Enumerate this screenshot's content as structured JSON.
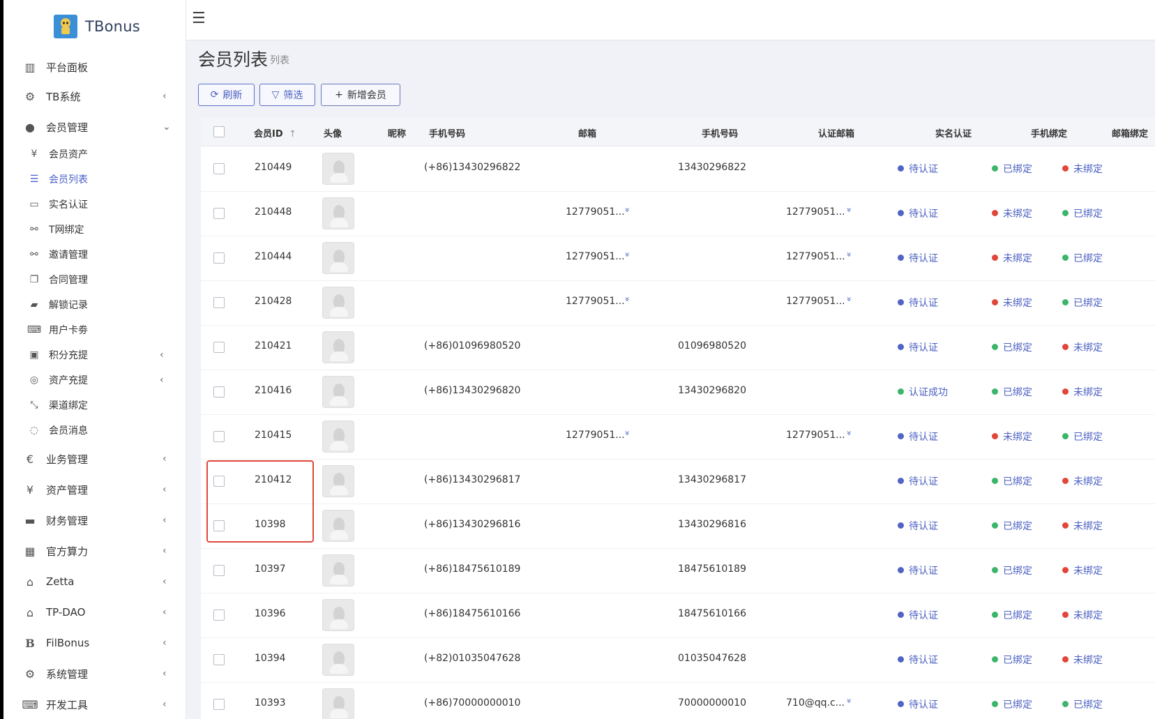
{
  "brand": {
    "name": "TBonus"
  },
  "sidebar": {
    "items": [
      {
        "label": "平台面板",
        "icon": "bar-chart-icon",
        "chev": ""
      },
      {
        "label": "TB系统",
        "icon": "cog-icon",
        "chev": "‹"
      },
      {
        "label": "会员管理",
        "icon": "user-icon",
        "chev": "⌄"
      },
      {
        "label": "会员资产",
        "icon": "yen-icon",
        "chev": ""
      },
      {
        "label": "会员列表",
        "icon": "list-icon",
        "chev": ""
      },
      {
        "label": "实名认证",
        "icon": "id-card-icon",
        "chev": ""
      },
      {
        "label": "T网绑定",
        "icon": "link-icon",
        "chev": ""
      },
      {
        "label": "邀请管理",
        "icon": "link-icon",
        "chev": ""
      },
      {
        "label": "合同管理",
        "icon": "file-copy-icon",
        "chev": ""
      },
      {
        "label": "解锁记录",
        "icon": "book-icon",
        "chev": ""
      },
      {
        "label": "用户卡劵",
        "icon": "keyboard-icon",
        "chev": ""
      },
      {
        "label": "积分充提",
        "icon": "database-icon",
        "chev": "‹"
      },
      {
        "label": "资产充提",
        "icon": "target-icon",
        "chev": "‹"
      },
      {
        "label": "渠道绑定",
        "icon": "compress-icon",
        "chev": ""
      },
      {
        "label": "会员消息",
        "icon": "comment-icon",
        "chev": ""
      },
      {
        "label": "业务管理",
        "icon": "euro-icon",
        "chev": "‹"
      },
      {
        "label": "资产管理",
        "icon": "yen-icon",
        "chev": "‹"
      },
      {
        "label": "财务管理",
        "icon": "discover-card-icon",
        "chev": "‹"
      },
      {
        "label": "官方算力",
        "icon": "calculator-icon",
        "chev": "‹"
      },
      {
        "label": "Zetta",
        "icon": "bank-icon",
        "chev": "‹"
      },
      {
        "label": "TP-DAO",
        "icon": "bank-icon",
        "chev": "‹"
      },
      {
        "label": "FilBonus",
        "icon": "bold-b-icon",
        "chev": "‹"
      },
      {
        "label": "系统管理",
        "icon": "gear-icon",
        "chev": "‹"
      },
      {
        "label": "开发工具",
        "icon": "keyboard-icon",
        "chev": "‹"
      }
    ]
  },
  "page": {
    "title": "会员列表",
    "subtitle": "列表"
  },
  "toolbar": {
    "refresh": "刷新",
    "filter": "筛选",
    "add": "新增会员"
  },
  "table": {
    "headers": [
      "会员ID",
      "头像",
      "昵称",
      "手机号码",
      "邮箱",
      "手机号码",
      "认证邮箱",
      "实名认证",
      "手机绑定",
      "邮箱绑定"
    ],
    "sort_icon": "↑",
    "rows": [
      {
        "id": "210449",
        "phone_full": "(+86)13430296822",
        "email": "",
        "phone": "13430296822",
        "auth_email": "",
        "realname": "待认证",
        "phone_bind": "已绑定",
        "email_bind": "未绑定"
      },
      {
        "id": "210448",
        "phone_full": "",
        "email": "12779051...",
        "phone": "",
        "auth_email": "12779051...",
        "realname": "待认证",
        "phone_bind": "未绑定",
        "email_bind": "已绑定"
      },
      {
        "id": "210444",
        "phone_full": "",
        "email": "12779051...",
        "phone": "",
        "auth_email": "12779051...",
        "realname": "待认证",
        "phone_bind": "未绑定",
        "email_bind": "已绑定"
      },
      {
        "id": "210428",
        "phone_full": "",
        "email": "12779051...",
        "phone": "",
        "auth_email": "12779051...",
        "realname": "待认证",
        "phone_bind": "未绑定",
        "email_bind": "已绑定"
      },
      {
        "id": "210421",
        "phone_full": "(+86)01096980520",
        "email": "",
        "phone": "01096980520",
        "auth_email": "",
        "realname": "待认证",
        "phone_bind": "已绑定",
        "email_bind": "未绑定"
      },
      {
        "id": "210416",
        "phone_full": "(+86)13430296820",
        "email": "",
        "phone": "13430296820",
        "auth_email": "",
        "realname": "认证成功",
        "phone_bind": "已绑定",
        "email_bind": "未绑定"
      },
      {
        "id": "210415",
        "phone_full": "",
        "email": "12779051...",
        "phone": "",
        "auth_email": "12779051...",
        "realname": "待认证",
        "phone_bind": "未绑定",
        "email_bind": "已绑定"
      },
      {
        "id": "210412",
        "phone_full": "(+86)13430296817",
        "email": "",
        "phone": "13430296817",
        "auth_email": "",
        "realname": "待认证",
        "phone_bind": "已绑定",
        "email_bind": "未绑定"
      },
      {
        "id": "10398",
        "phone_full": "(+86)13430296816",
        "email": "",
        "phone": "13430296816",
        "auth_email": "",
        "realname": "待认证",
        "phone_bind": "已绑定",
        "email_bind": "未绑定"
      },
      {
        "id": "10397",
        "phone_full": "(+86)18475610189",
        "email": "",
        "phone": "18475610189",
        "auth_email": "",
        "realname": "待认证",
        "phone_bind": "已绑定",
        "email_bind": "未绑定"
      },
      {
        "id": "10396",
        "phone_full": "(+86)18475610166",
        "email": "",
        "phone": "18475610166",
        "auth_email": "",
        "realname": "待认证",
        "phone_bind": "已绑定",
        "email_bind": "未绑定"
      },
      {
        "id": "10394",
        "phone_full": "(+82)01035047628",
        "email": "",
        "phone": "01035047628",
        "auth_email": "",
        "realname": "待认证",
        "phone_bind": "已绑定",
        "email_bind": "未绑定"
      },
      {
        "id": "10393",
        "phone_full": "(+86)70000000010",
        "email": "",
        "phone": "70000000010",
        "auth_email": "710@qq.c...",
        "realname": "待认证",
        "phone_bind": "已绑定",
        "email_bind": "已绑定"
      }
    ]
  },
  "colors": {
    "accent": "#4a61c7",
    "status_blue": "#5163c4",
    "status_green": "#3cb56a",
    "status_red": "#e0463a",
    "highlight": "#e0463a"
  }
}
